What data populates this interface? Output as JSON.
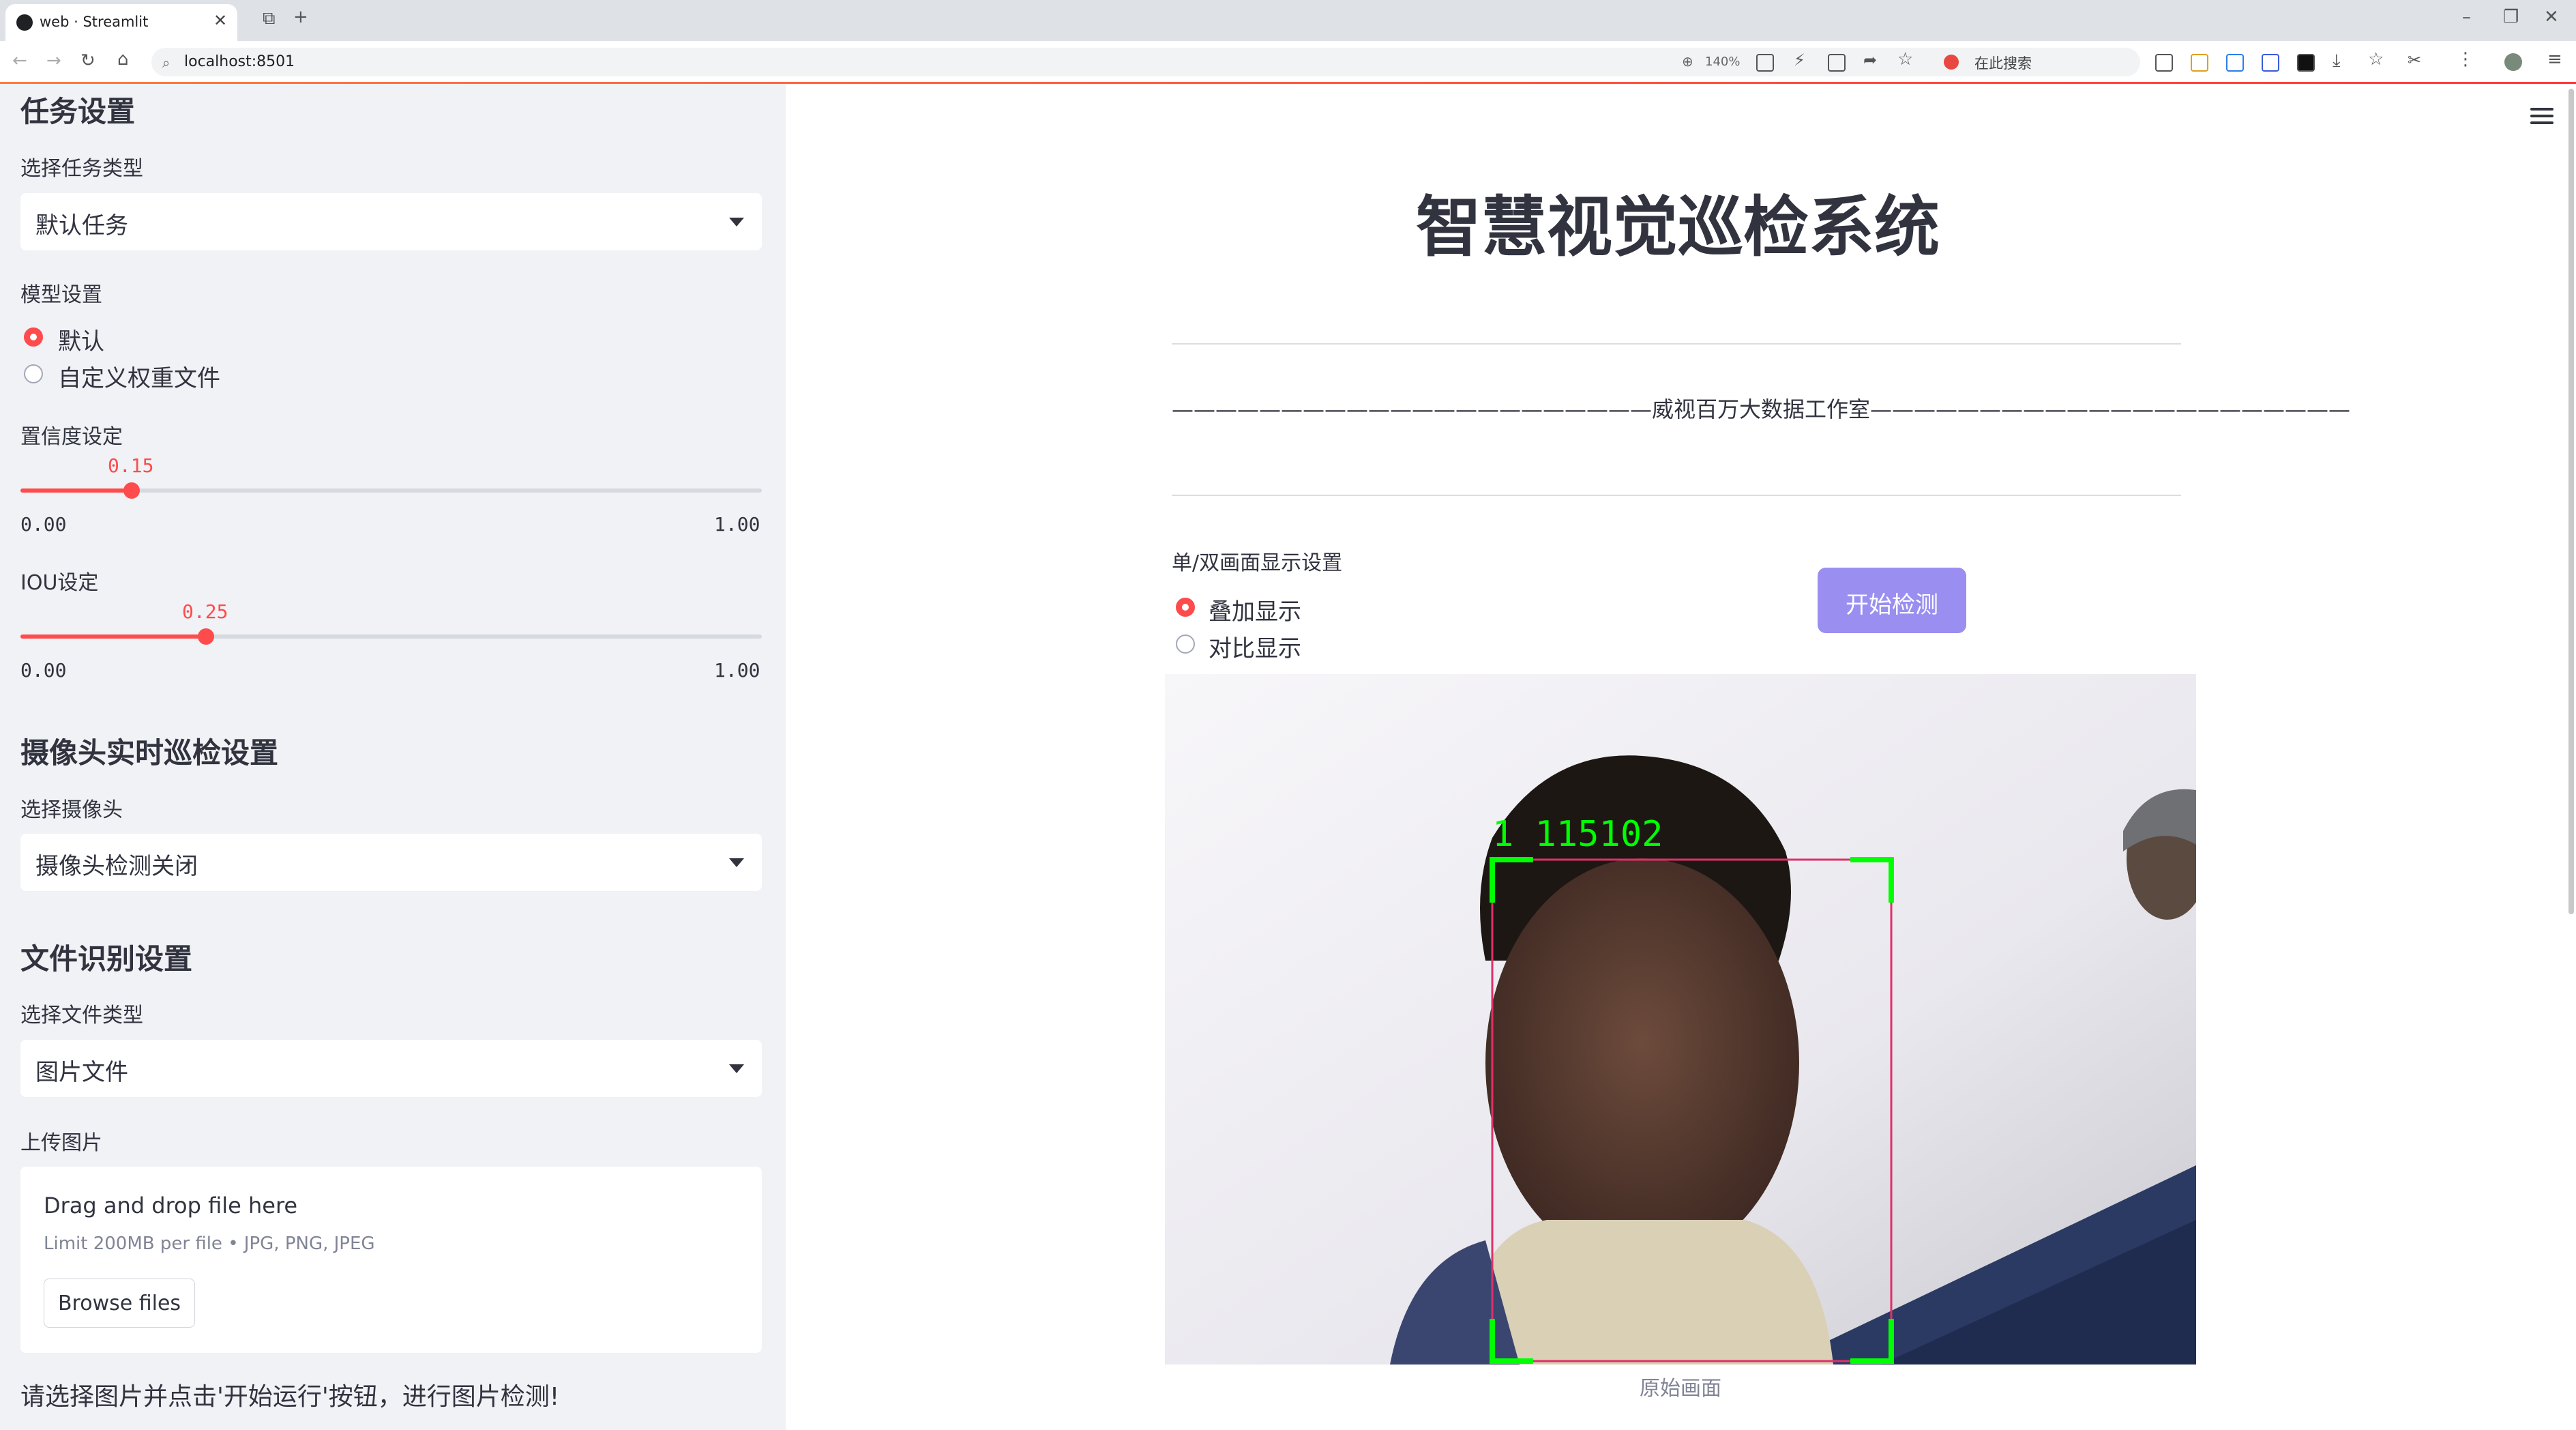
{
  "browser": {
    "tab_title": "web · Streamlit",
    "url": "localhost:8501",
    "zoom": "140%",
    "search_placeholder": "在此搜索"
  },
  "sidebar": {
    "task_section": "任务设置",
    "task_type_label": "选择任务类型",
    "task_type_value": "默认任务",
    "model_label": "模型设置",
    "model_options": [
      "默认",
      "自定义权重文件"
    ],
    "model_selected": "默认",
    "conf_label": "置信度设定",
    "conf_value": "0.15",
    "conf_min": "0.00",
    "conf_max": "1.00",
    "iou_label": "IOU设定",
    "iou_value": "0.25",
    "iou_min": "0.00",
    "iou_max": "1.00",
    "camera_section": "摄像头实时巡检设置",
    "camera_label": "选择摄像头",
    "camera_value": "摄像头检测关闭",
    "file_section": "文件识别设置",
    "file_type_label": "选择文件类型",
    "file_type_value": "图片文件",
    "upload_label": "上传图片",
    "drag_text": "Drag and drop file here",
    "limit_text": "Limit 200MB per file • JPG, PNG, JPEG",
    "browse_label": "Browse files",
    "hint": "请选择图片并点击'开始运行'按钮，进行图片检测!"
  },
  "main": {
    "title": "智慧视觉巡检系统",
    "subtitle": "——————————————————————威视百万大数据工作室——————————————————————",
    "display_label": "单/双画面显示设置",
    "display_options": [
      "叠加显示",
      "对比显示"
    ],
    "display_selected": "叠加显示",
    "start_button": "开始检测",
    "detection_label": "1 115102",
    "caption": "原始画面"
  },
  "colors": {
    "accent": "#ff4b4b",
    "button": "#9a8ff0",
    "box": "#00ff00",
    "box_inner": "#e0306a"
  }
}
